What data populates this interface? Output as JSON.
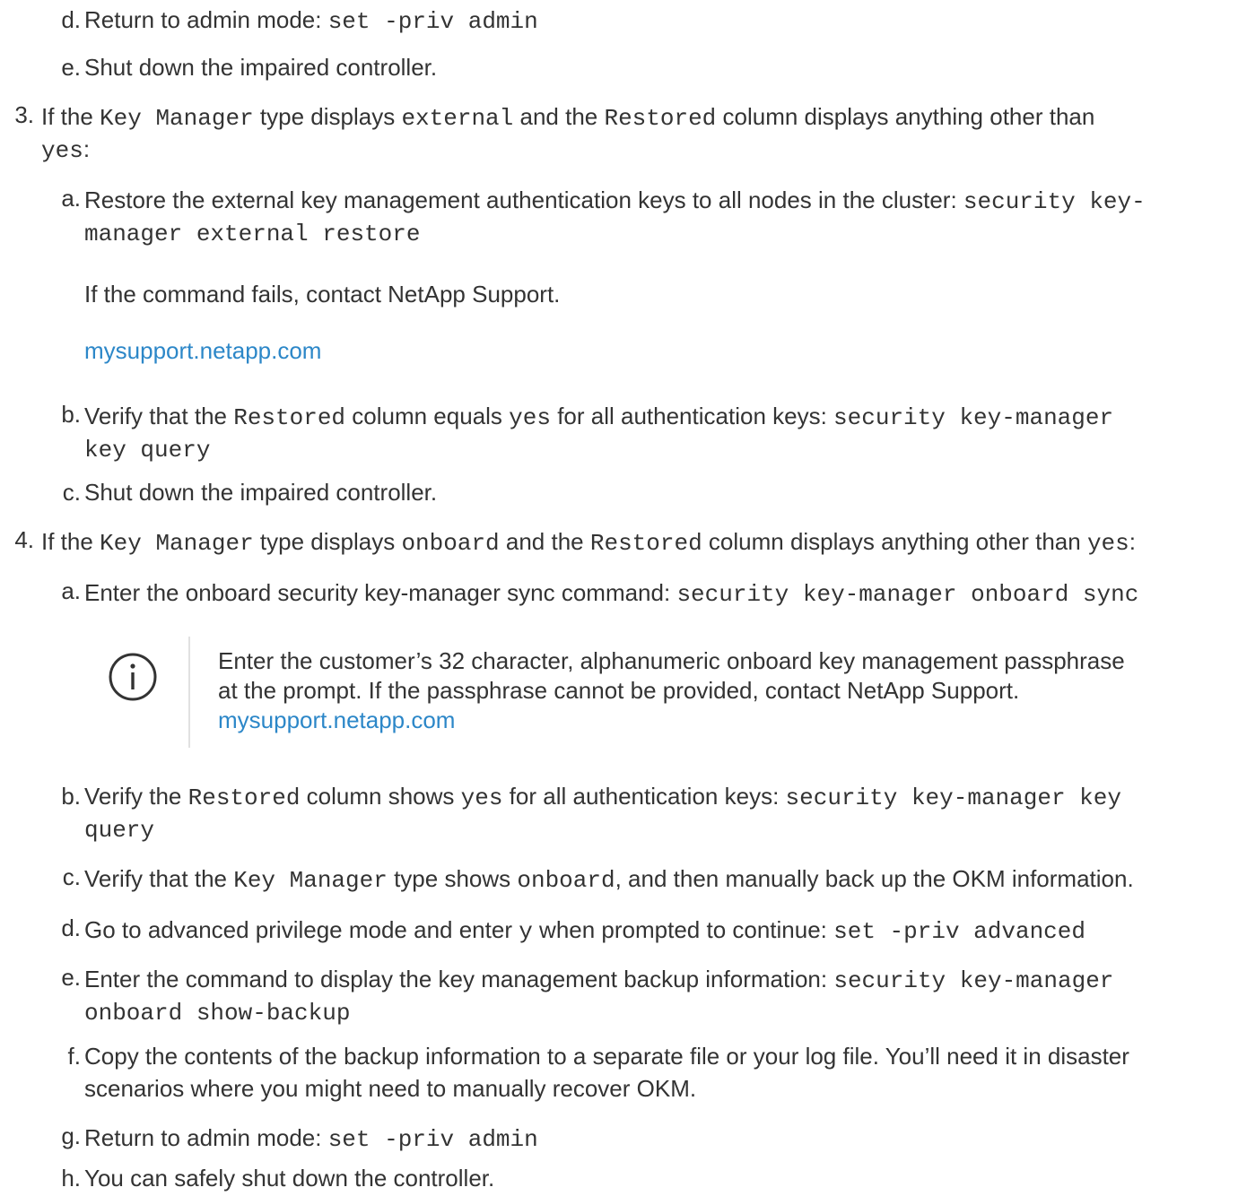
{
  "top_steps": {
    "d": {
      "label": "d.",
      "text": "Return to admin mode: ",
      "cmd": "set -priv admin"
    },
    "e": {
      "label": "e.",
      "text": "Shut down the impaired controller."
    }
  },
  "step3": {
    "number": "3.",
    "t1": "If the ",
    "c1": "Key Manager",
    "t2": " type displays ",
    "c2": "external",
    "t3": " and the ",
    "c3": "Restored",
    "t4": " column displays anything other than",
    "c4": "yes",
    "t5": ":",
    "a": {
      "label": "a.",
      "text": "Restore the external key management authentication keys to all nodes in the cluster: ",
      "cmd1": "security key-",
      "cmd2": "manager external restore"
    },
    "fail_text": "If the command fails, contact NetApp Support.",
    "support_link": "mysupport.netapp.com",
    "b": {
      "label": "b.",
      "t1": "Verify that the ",
      "c1": "Restored",
      "t2": " column equals ",
      "c2": "yes",
      "t3": " for all authentication keys: ",
      "cmd1": "security key-manager",
      "cmd2": "key query"
    },
    "c": {
      "label": "c.",
      "text": "Shut down the impaired controller."
    }
  },
  "step4": {
    "number": "4.",
    "t1": "If the ",
    "c1": "Key Manager",
    "t2": " type displays ",
    "c2": "onboard",
    "t3": " and the ",
    "c3": "Restored",
    "t4": " column displays anything other than ",
    "c4": "yes",
    "t5": ":",
    "a": {
      "label": "a.",
      "text": "Enter the onboard security key-manager sync command: ",
      "cmd": "security key-manager onboard sync"
    },
    "note": {
      "line1": "Enter the customer’s 32 character, alphanumeric onboard key management passphrase",
      "line2": "at the prompt. If the passphrase cannot be provided, contact NetApp Support.",
      "link": "mysupport.netapp.com"
    },
    "b": {
      "label": "b.",
      "t1": "Verify the ",
      "c1": "Restored",
      "t2": " column shows ",
      "c2": "yes",
      "t3": " for all authentication keys: ",
      "cmd1": "security key-manager key",
      "cmd2": "query"
    },
    "c": {
      "label": "c.",
      "t1": "Verify that the ",
      "c1": "Key Manager",
      "t2": " type shows ",
      "c2": "onboard",
      "t3": ", and then manually back up the OKM information."
    },
    "d": {
      "label": "d.",
      "t1": "Go to advanced privilege mode and enter ",
      "c1": "y",
      "t2": " when prompted to continue: ",
      "cmd": "set -priv advanced"
    },
    "e": {
      "label": "e.",
      "text": "Enter the command to display the key management backup information: ",
      "cmd1": "security key-manager",
      "cmd2": "onboard show-backup"
    },
    "f": {
      "label": "f.",
      "line1": "Copy the contents of the backup information to a separate file or your log file. You’ll need it in disaster",
      "line2": "scenarios where you might need to manually recover OKM."
    },
    "g": {
      "label": "g.",
      "text": "Return to admin mode: ",
      "cmd": "set -priv admin"
    },
    "h": {
      "label": "h.",
      "text": "You can safely shut down the controller."
    }
  },
  "colors": {
    "text": "#333333",
    "link": "#2c87c8",
    "note_bar": "#e1e1e1"
  },
  "icons": {
    "note": "info-circle-icon"
  }
}
